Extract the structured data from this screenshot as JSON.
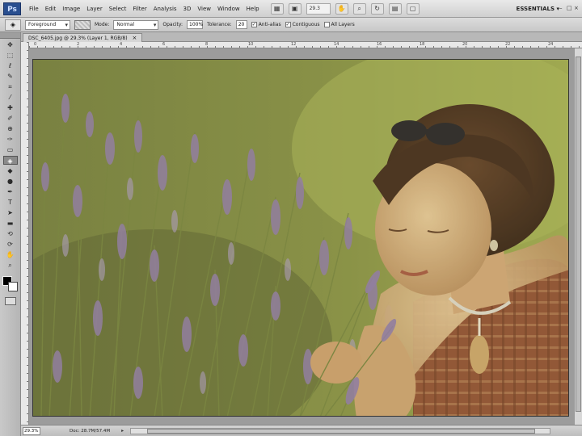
{
  "app": {
    "logo": "Ps",
    "workspace": "ESSENTIALS",
    "workspace_arrow": "▾",
    "zoom": "29.3",
    "menu": [
      "File",
      "Edit",
      "Image",
      "Layer",
      "Select",
      "Filter",
      "Analysis",
      "3D",
      "View",
      "Window",
      "Help"
    ]
  },
  "options": {
    "fill_source": "Foreground",
    "mode_label": "Mode:",
    "mode_value": "Normal",
    "opacity_label": "Opacity:",
    "opacity_value": "100%",
    "tolerance_label": "Tolerance:",
    "tolerance_value": "20",
    "antialias_label": "Anti-alias",
    "contiguous_label": "Contiguous",
    "all_layers_label": "All Layers"
  },
  "document": {
    "tab_title": "DSC_6405.jpg @ 29.3% (Layer 1, RGB/8)",
    "close": "×"
  },
  "status": {
    "zoom": "29.3%",
    "doc_info": "Doc: 28.7M/57.4M",
    "arrow": "▸"
  },
  "ruler_numbers": [
    "0",
    "2",
    "4",
    "6",
    "8",
    "10",
    "12",
    "14",
    "16",
    "18",
    "20",
    "22",
    "24"
  ],
  "colors": {
    "foreground": "#000000",
    "background": "#ffffff"
  },
  "photo": {
    "subject": "woman smelling lavender field"
  },
  "tools": [
    "move",
    "marquee",
    "lasso",
    "quick-select",
    "crop",
    "eyedropper",
    "healing",
    "brush",
    "clone",
    "history-brush",
    "eraser",
    "paint-bucket",
    "blur",
    "dodge",
    "pen",
    "type",
    "path-select",
    "shape",
    "hand",
    "zoom"
  ],
  "active_tool": "paint-bucket"
}
